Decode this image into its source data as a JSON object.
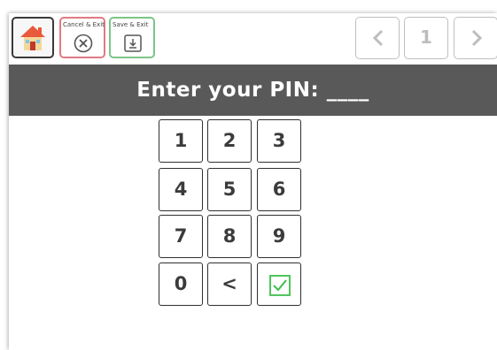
{
  "toolbar": {
    "cancel_label": "Cancel & Exit",
    "save_label": "Save & Exit",
    "page_number": "1"
  },
  "header": {
    "title": "Enter your PIN: ____"
  },
  "keypad": {
    "k1": "1",
    "k2": "2",
    "k3": "3",
    "k4": "4",
    "k5": "5",
    "k6": "6",
    "k7": "7",
    "k8": "8",
    "k9": "9",
    "k0": "0",
    "back": "<"
  },
  "colors": {
    "header_bg": "#595959",
    "cancel_border": "#e07b83",
    "save_border": "#7cc687",
    "confirm_green": "#3cbf4a"
  },
  "icons": {
    "home": "house-icon",
    "cancel": "circle-x-icon",
    "save": "download-icon",
    "prev": "chevron-left-icon",
    "next": "chevron-right-icon",
    "confirm": "checkbox-check-icon"
  }
}
